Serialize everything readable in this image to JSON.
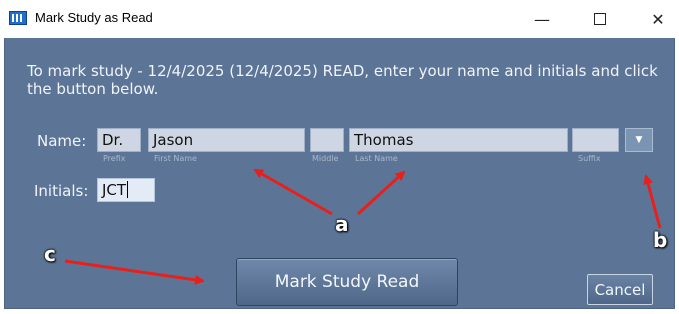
{
  "window": {
    "title": "Mark Study as Read",
    "minimize_glyph": "—",
    "close_glyph": "✕"
  },
  "dialog": {
    "instructions": "To mark study  - 12/4/2025 (12/4/2025) READ, enter your name and initials and click the button below."
  },
  "name_section": {
    "label": "Name:",
    "fields": {
      "prefix": {
        "value": "Dr.",
        "caption": "Prefix"
      },
      "first": {
        "value": "Jason",
        "caption": "First Name"
      },
      "middle": {
        "value": "",
        "caption": "Middle"
      },
      "last": {
        "value": "Thomas",
        "caption": "Last Name"
      },
      "suffix": {
        "value": "",
        "caption": "Suffix"
      }
    },
    "dropdown_icon": "chevron-down-icon",
    "dropdown_glyph": "▼"
  },
  "initials_section": {
    "label": "Initials:",
    "value": "JCT"
  },
  "buttons": {
    "mark_read": "Mark Study Read",
    "cancel": "Cancel"
  },
  "annotations": {
    "a": "a",
    "b": "b",
    "c": "c",
    "color": "#e8201c"
  },
  "colors": {
    "dialog_bg": "#5c7597",
    "field_bg": "#cdd6e2",
    "text": "#f0f3f7"
  }
}
